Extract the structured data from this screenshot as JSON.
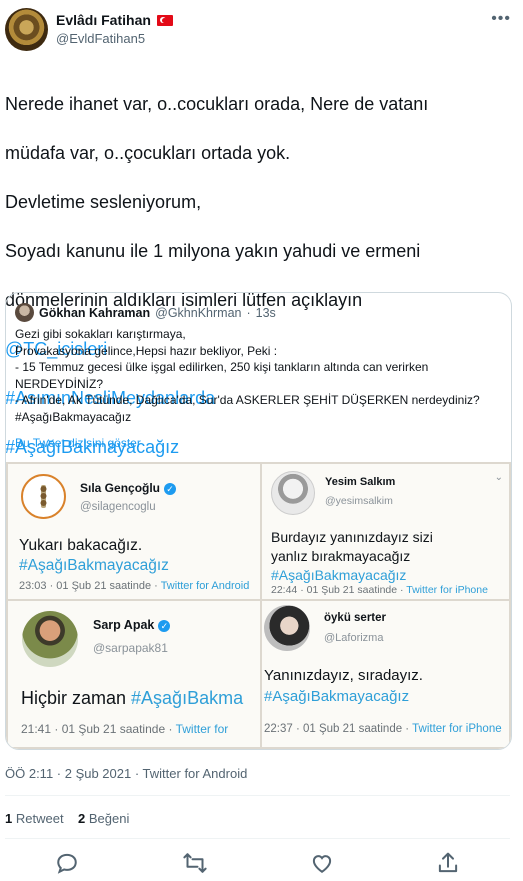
{
  "author": {
    "display_name": "Evlâdı Fatihan",
    "handle": "@EvldFatihan5"
  },
  "tweet_lines": [
    "Nerede ihanet var, o..cocukları orada, Nere de vatanı",
    "müdafa var, o..çocukları ortada yok.",
    "Devletime sesleniyorum,",
    "Soyadı kanunu ile  1 milyona yakın yahudi ve ermeni",
    "dönmelerinin aldıkları isimleri lütfen açıklayın"
  ],
  "tweet_links": [
    "@TC_icisleri",
    "#AsımınNesliMeydanlarda",
    "#AşağıBakmayacağız"
  ],
  "quote": {
    "name": "Gökhan Kahraman",
    "handle": "@GkhnKhrman",
    "separator": "·",
    "time": "13s",
    "lines": [
      "Gezi gibi sokakları karıştırmaya,",
      "Provakasyona gelince,Hepsi hazır bekliyor, Peki :",
      "- 15 Temmuz gecesi ülke işgal edilirken, 250 kişi tankların altında can verirken",
      "NERDEYDİNİZ?",
      "- Afrin'de, Ak Tütünde, Dağlıca'da, Sur'da ASKERLER ŞEHİT DÜŞERKEN nerdeydiniz?",
      "#AşağıBakmayacağız"
    ],
    "thread_link": "Bu Tweet dizisini göster"
  },
  "cards": [
    {
      "name": "Sıla Gençoğlu",
      "handle": "@silagencoglu",
      "text_lines": [
        "Yukarı bakacağız."
      ],
      "hashtag": "#AşağıBakmayacağız",
      "time": "23:03 · 01 Şub 21 saatinde · ",
      "source": "Twitter for Android",
      "verified": true
    },
    {
      "name": "Yesim Salkım",
      "handle": "@yesimsalkim",
      "text_lines": [
        "Burdayız yanınızdayız sizi",
        "yanlız bırakmayacağız"
      ],
      "hashtag": "#AşağıBakmayacağız",
      "time": "22:44 · 01 Şub 21 saatinde · ",
      "source": "Twitter for iPhone",
      "verified": false
    },
    {
      "name": "Sarp Apak",
      "handle": "@sarpapak81",
      "text_lines": [
        "Hiçbir zaman "
      ],
      "hashtag": "#AşağıBakma",
      "time": "21:41 · 01 Şub 21 saatinde · ",
      "source": "Twitter for",
      "verified": true
    },
    {
      "name": "öykü serter",
      "handle": "@Laforizma",
      "text_lines": [
        "Yanınızdayız, sıradayız."
      ],
      "hashtag": "#AşağıBakmayacağız",
      "time": "22:37 · 01 Şub 21 saatinde · ",
      "source": "Twitter for iPhone",
      "verified": false
    }
  ],
  "meta": "ÖÖ 2:11 · 2 Şub 2021 · Twitter for Android",
  "stats": {
    "retweets": "1",
    "retweets_label": "Retweet",
    "likes": "2",
    "likes_label": "Beğeni"
  },
  "icons": [
    "more-icon",
    "reply-icon",
    "retweet-icon",
    "like-icon",
    "share-icon",
    "verified-icon",
    "flag-icon"
  ]
}
